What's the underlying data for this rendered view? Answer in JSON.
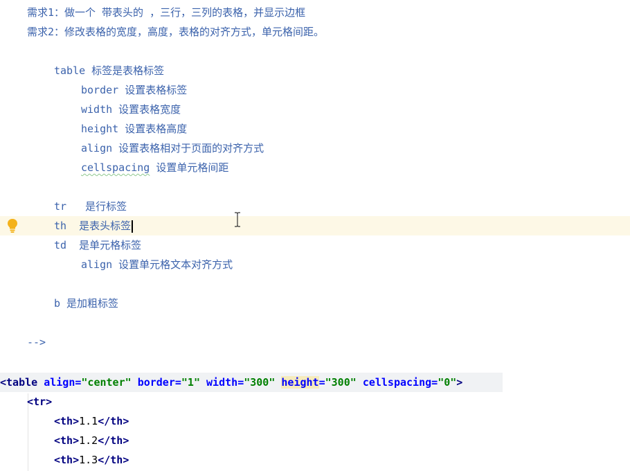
{
  "comment": {
    "req1": "需求1：做一个 带表头的 ，三行，三列的表格，并显示边框",
    "req2": "需求2：修改表格的宽度，高度，表格的对齐方式，单元格间距。",
    "table_line": "table 标签是表格标签",
    "border_line": "border 设置表格标签",
    "width_line": "width 设置表格宽度",
    "height_line": "height 设置表格高度",
    "align_line": "align 设置表格相对于页面的对齐方式",
    "cellspacing_word": "cellspacing",
    "cellspacing_desc": " 设置单元格间距",
    "tr_line": "tr   是行标签",
    "th_line": "th  是表头标签",
    "td_line": "td  是单元格标签",
    "td_align_line": "align 设置单元格文本对齐方式",
    "b_line": "b 是加粗标签",
    "close": "-->"
  },
  "code": {
    "lt": "<",
    "table_tag": "table",
    "align_attr": "align",
    "align_val": "\"center\"",
    "border_attr": "border",
    "border_val": "\"1\"",
    "width_attr": "width",
    "width_val": "\"300\"",
    "height_attr": "height",
    "height_val": "\"300\"",
    "cellspacing_attr": "cellspacing",
    "cellspacing_val": "\"0\"",
    "gt": ">",
    "eq": "=",
    "tr_open": "<tr>",
    "th_rows": [
      {
        "open": "<th>",
        "text": "1.1",
        "close": "</th>"
      },
      {
        "open": "<th>",
        "text": "1.2",
        "close": "</th>"
      },
      {
        "open": "<th>",
        "text": "1.3",
        "close": "</th>"
      }
    ]
  },
  "colors": {
    "comment": "#3c63ac",
    "tag": "#000080",
    "attribute": "#0000ff",
    "value": "#008000",
    "current_line": "#fdf8e6",
    "highlight_word": "#f6ebbc"
  },
  "icons": {
    "gutter": "lightbulb-icon",
    "cursor": "text-cursor-icon"
  }
}
